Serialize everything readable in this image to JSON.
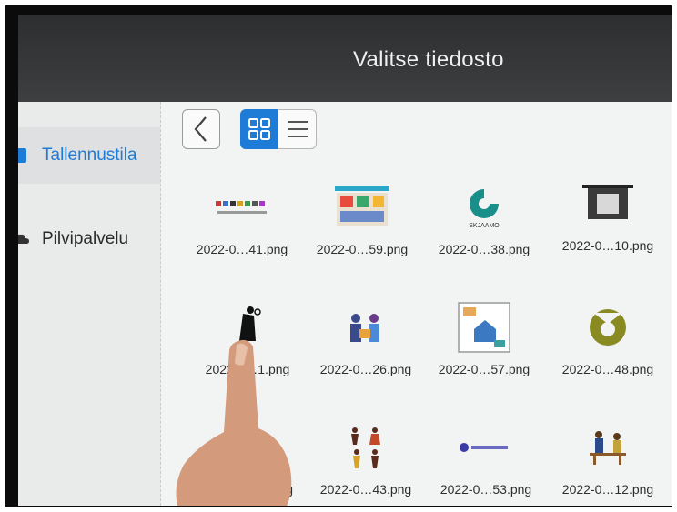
{
  "dialog": {
    "title": "Valitse tiedosto"
  },
  "sidebar": {
    "items": [
      {
        "label": "Tallennustila",
        "icon": "phone-icon",
        "active": true
      },
      {
        "label": "Pilvipalvelu",
        "icon": "cloud-icon",
        "active": false
      }
    ]
  },
  "toolbar": {
    "back_icon": "chevron-left-icon",
    "view_modes": [
      {
        "icon": "grid-view-icon",
        "selected": true
      },
      {
        "icon": "list-view-icon",
        "selected": false
      }
    ],
    "accent": "#1e7bd6"
  },
  "files": [
    {
      "name": "2022-0…41.png"
    },
    {
      "name": "2022-0…59.png"
    },
    {
      "name": "2022-0…38.png"
    },
    {
      "name": "2022-0…10.png"
    },
    {
      "name": "2022-0…1.png"
    },
    {
      "name": "2022-0…26.png"
    },
    {
      "name": "2022-0…57.png"
    },
    {
      "name": "2022-0…48.png"
    },
    {
      "name": "g"
    },
    {
      "name": "2022-0…43.png"
    },
    {
      "name": "2022-0…53.png"
    },
    {
      "name": "2022-0…12.png"
    }
  ],
  "thumbnails": {
    "logo_text": "SKJAAMO"
  }
}
